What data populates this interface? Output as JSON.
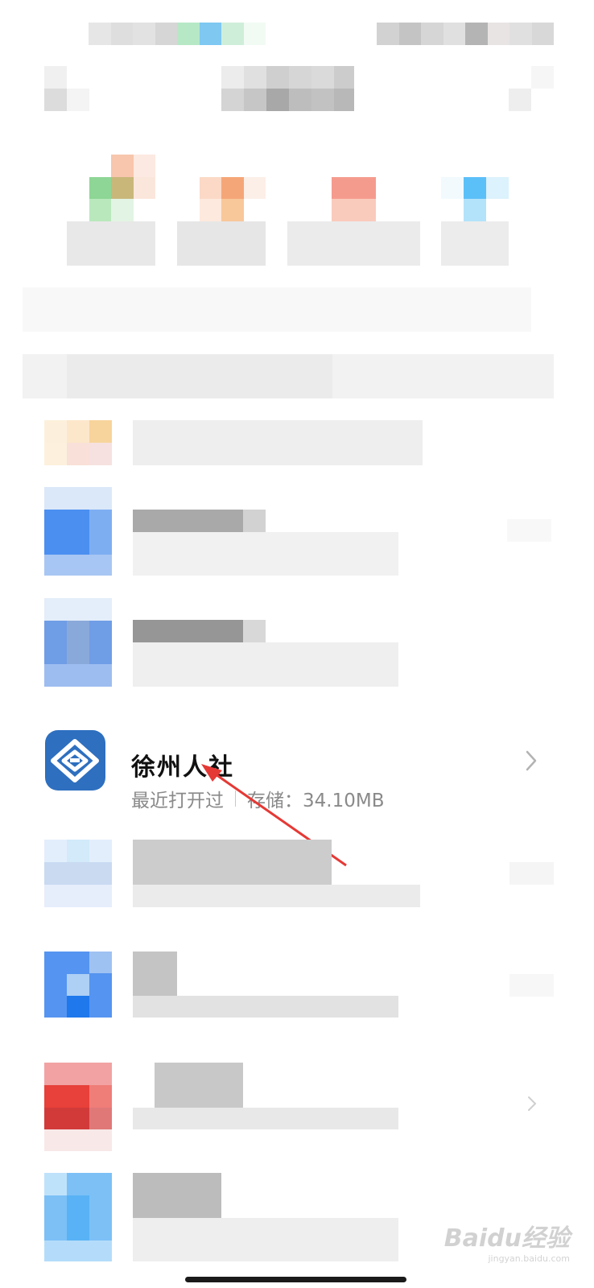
{
  "focused_app": {
    "name": "徐州人社",
    "last_opened": "最近打开过",
    "storage_label": "存储：34.10MB",
    "icon": "app-logo-icon",
    "icon_color": "#2e6fbf"
  },
  "chevron_icon": "chevron-right-icon",
  "annotation": {
    "color": "#e53935"
  },
  "watermark": {
    "brand": "Baidu经验",
    "site": "jingyan.baidu.com"
  }
}
